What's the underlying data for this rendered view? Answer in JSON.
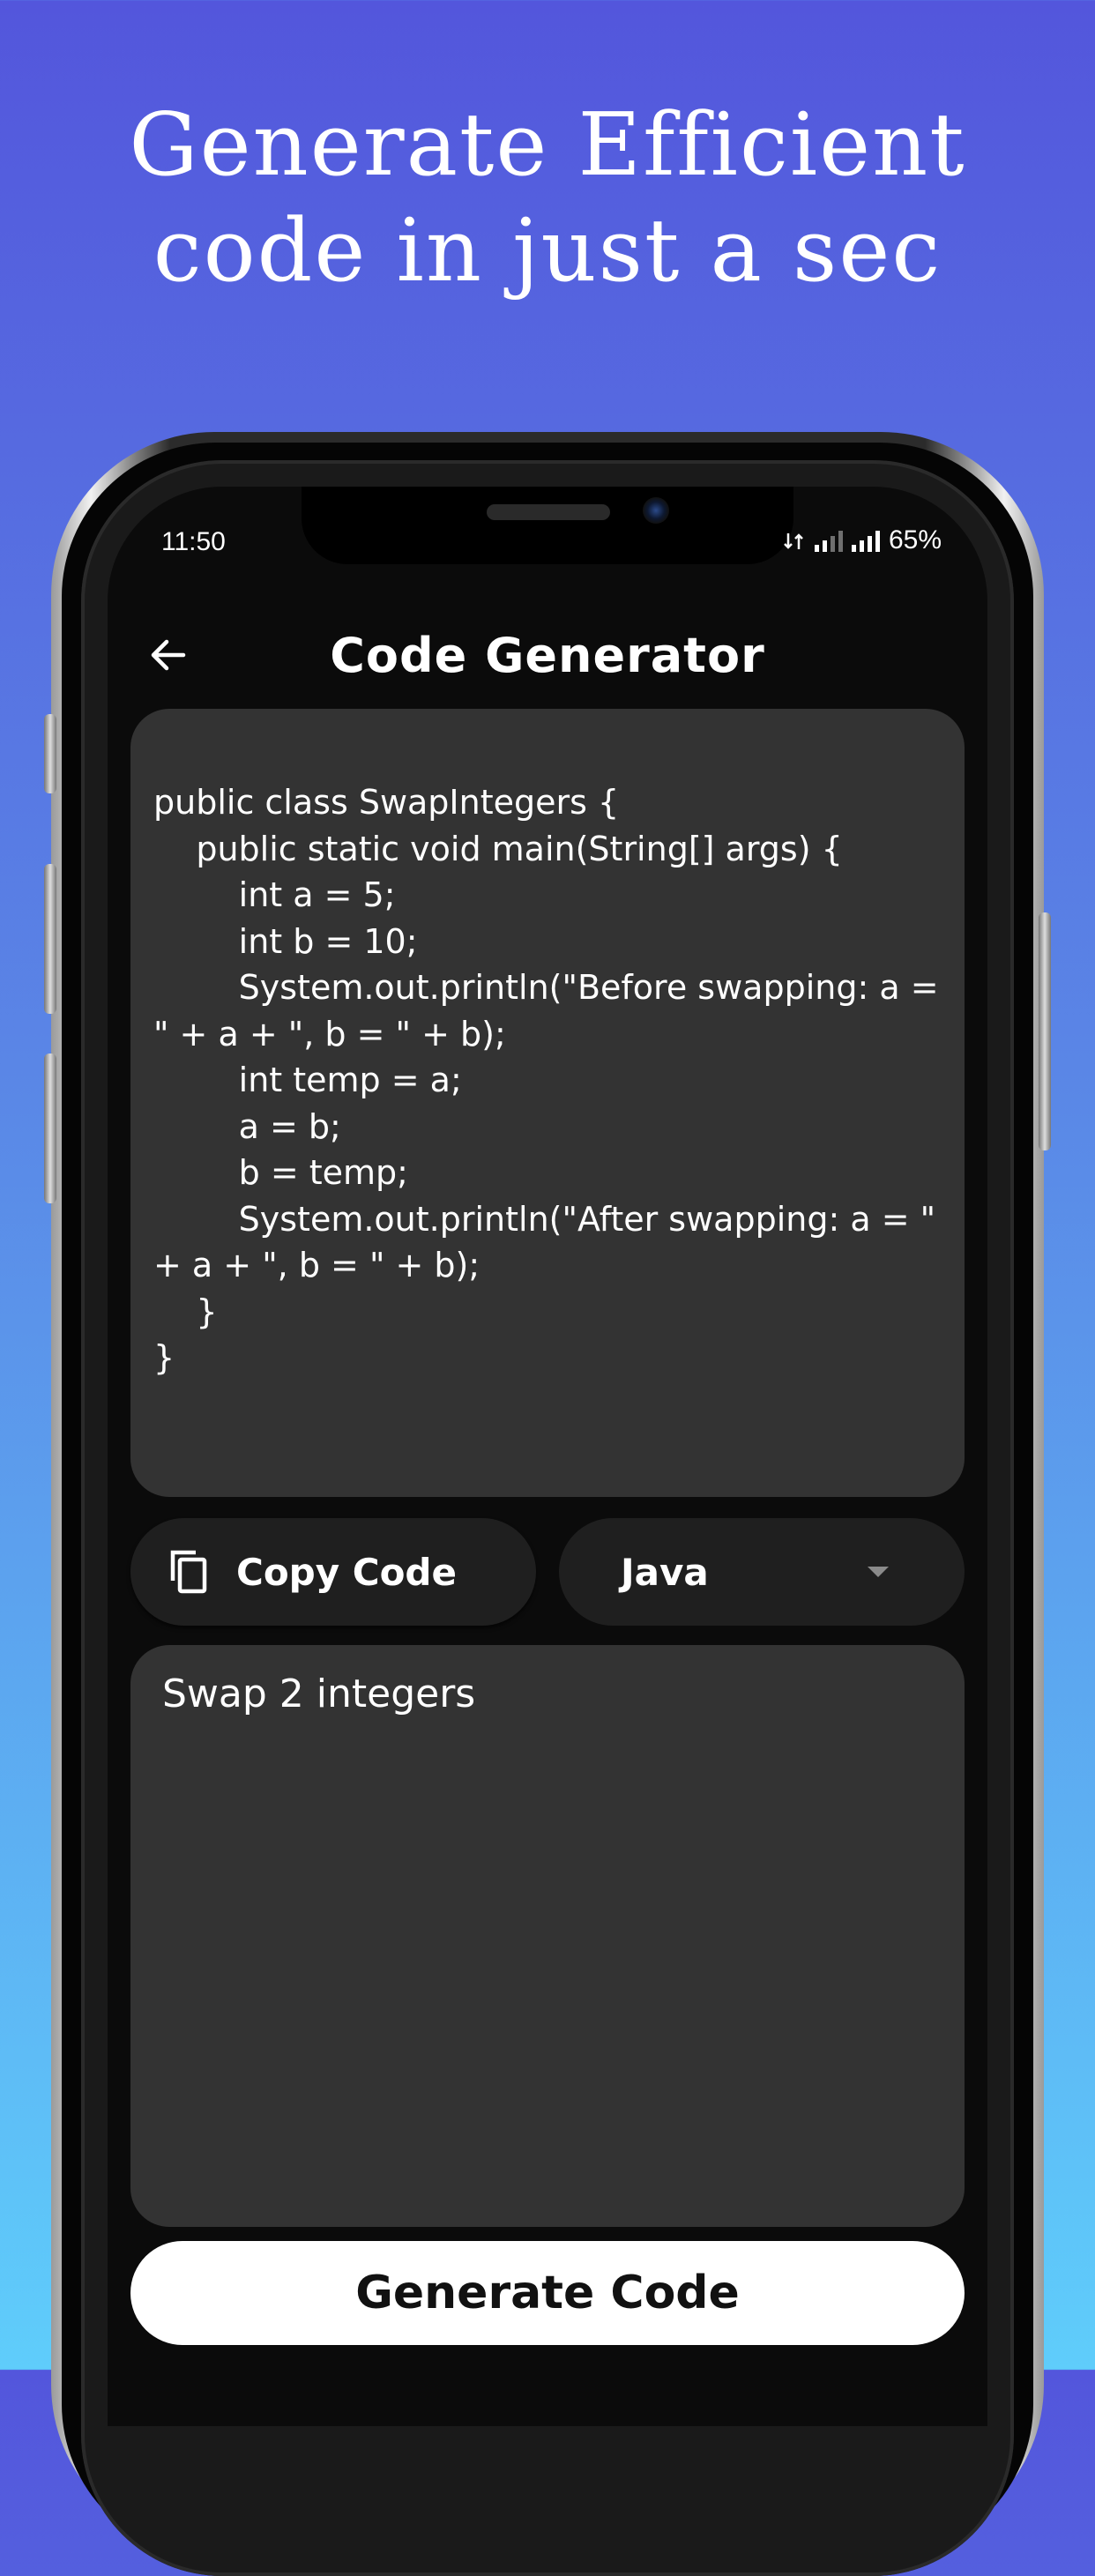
{
  "promo": {
    "headline_line1": "Generate Efficient",
    "headline_line2": "code in just a sec"
  },
  "status_bar": {
    "time": "11:50",
    "battery": "65%"
  },
  "app_bar": {
    "title": "Code Generator",
    "back_icon": "arrow-left-icon"
  },
  "code_output": {
    "text": "public class SwapIntegers {\n    public static void main(String[] args) {\n        int a = 5;\n        int b = 10;\n        System.out.println(\"Before swapping: a = \" + a + \", b = \" + b);\n        int temp = a;\n        a = b;\n        b = temp;\n        System.out.println(\"After swapping: a = \" + a + \", b = \" + b);\n    }\n}"
  },
  "controls": {
    "copy_label": "Copy Code",
    "copy_icon": "copy-icon",
    "language": "Java",
    "dropdown_icon": "caret-down-icon"
  },
  "prompt": {
    "value": "Swap 2 integers"
  },
  "generate_button": {
    "label": "Generate Code"
  },
  "colors": {
    "background_top": "#5356dc",
    "background_bottom": "#5fcdfb",
    "screen_bg": "#0b0b0b",
    "card_bg": "#333333",
    "control_bg": "#1f1f1f",
    "primary_button": "#ffffff"
  }
}
